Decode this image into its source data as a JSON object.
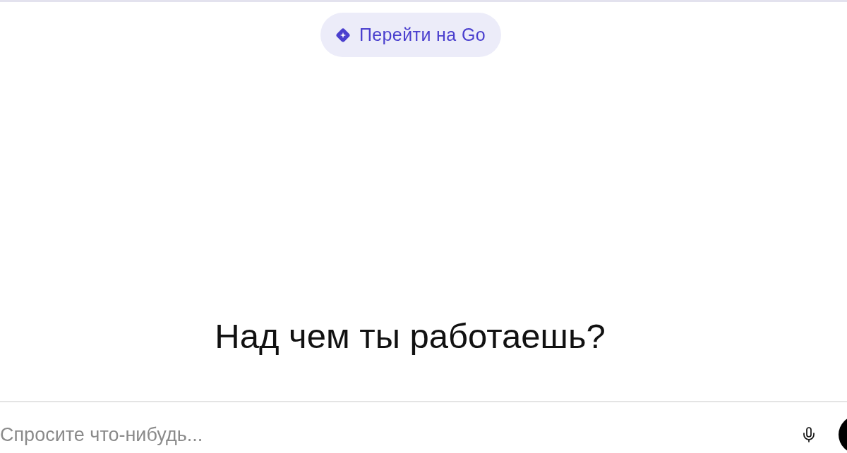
{
  "upgrade_button": {
    "label": "Перейти на Go"
  },
  "heading": "Над чем ты работаешь?",
  "composer": {
    "placeholder": "Спросите что-нибудь..."
  }
}
